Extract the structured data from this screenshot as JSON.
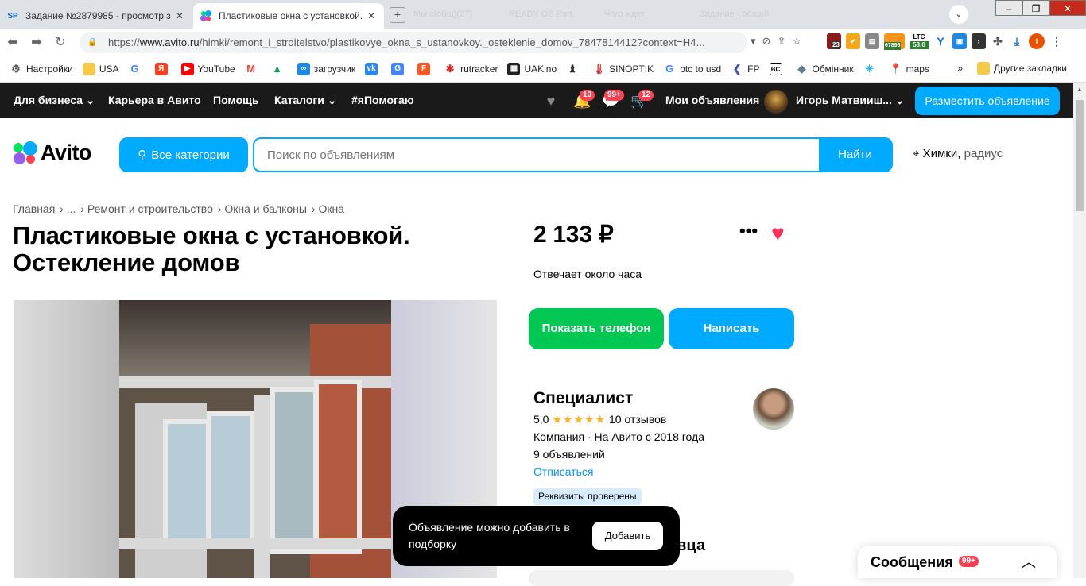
{
  "browser": {
    "tabs": [
      {
        "label": "Задание №2879985 - просмотр з",
        "favicon": "SP"
      },
      {
        "label": "Пластиковые окна с установкой.",
        "favicon": "avito-icon"
      }
    ],
    "ghost_tabs": [
      "Мы с(общ)(27)",
      "READY OS Part",
      "Чего ждет",
      "Задание - общий"
    ],
    "url_prefix": "https://",
    "url_domain": "www.avito.ru",
    "url_path": "/himki/remont_i_stroitelstvo/plastikovye_okna_s_ustanovkoy._osteklenie_domov_7847814412?context=H4...",
    "ext_badges": [
      "23",
      "67896",
      "LTC",
      "53.0"
    ],
    "profile_initial": "I"
  },
  "bookmarks": {
    "items": [
      "Настройки",
      "USA",
      "",
      "",
      "YouTube",
      "",
      "",
      "загрузчик",
      "",
      "",
      "",
      "rutracker",
      "UAKino",
      "",
      "SINOPTIK",
      "btc to usd",
      "FP",
      "",
      "Обмінник",
      "",
      "maps"
    ],
    "more": "»",
    "other": "Другие закладки"
  },
  "topnav": {
    "for_business": "Для бизнеса",
    "career": "Карьера в Авито",
    "help": "Помощь",
    "catalogs": "Каталоги",
    "ihelp": "#яПомогаю",
    "notif_badge": "10",
    "chat_badge": "99+",
    "cart_badge": "12",
    "my_ads": "Мои объявления",
    "user_name": "Игорь Матвииш...",
    "post_ad": "Разместить объявление"
  },
  "header": {
    "logo": "Avito",
    "all_categories": "Все категории",
    "search_placeholder": "Поиск по объявлениям",
    "search_button": "Найти",
    "location": "Химки,",
    "radius": "радиус"
  },
  "breadcrumbs": [
    "Главная",
    "...",
    "Ремонт и строительство",
    "Окна и балконы",
    "Окна"
  ],
  "listing": {
    "title": "Пластиковые окна с установкой. Остекление домов",
    "price": "2 133 ₽",
    "response_time": "Отвечает около часа",
    "show_phone": "Показать телефон",
    "write": "Написать"
  },
  "seller": {
    "name": "Специалист",
    "rating": "5,0",
    "stars": "★★★★★",
    "reviews": "10 отзывов",
    "company": "Компания · На Авито с 2018 года",
    "ads_count": "9 объявлений",
    "unsubscribe": "Отписаться",
    "verified": "Реквизиты проверены"
  },
  "toast": {
    "message": "Объявление можно добавить в подборку",
    "add": "Добавить"
  },
  "section_partial": "авца",
  "messenger": {
    "label": "Сообщения",
    "badge": "99+"
  }
}
